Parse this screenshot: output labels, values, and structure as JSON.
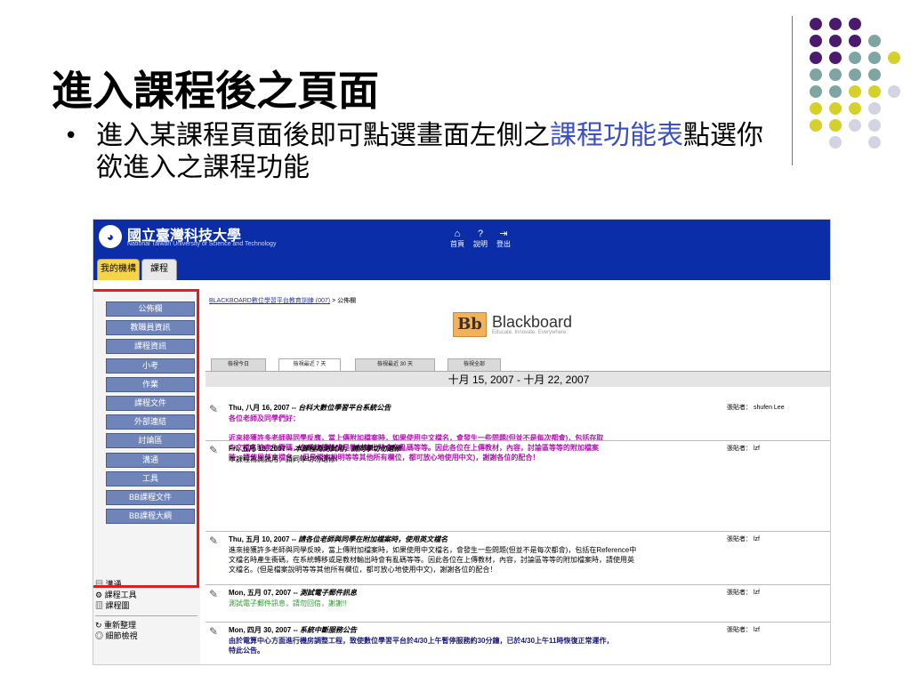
{
  "slide": {
    "title": "進入課程後之頁面",
    "bullet_pre": "進入某課程頁面後即可點選畫面左側之",
    "bullet_highlight": "課程功能表",
    "bullet_post": "點選你欲進入之課程功能",
    "bullet_marker": "•",
    "colors": {
      "title": "#000000",
      "highlight": "#3a4fc0",
      "dot_purple": "#4b1a6e",
      "dot_teal": "#7fa5a3",
      "dot_yellow": "#d6d12a",
      "dot_lavender": "#d3d3e4"
    }
  },
  "screenshot": {
    "logo_mark": "◕",
    "university_name": "國立臺灣科技大學",
    "university_name_en": "National Taiwan University of Science and Technology",
    "tabs": [
      "我的機構",
      "課程"
    ],
    "top_nav": [
      {
        "icon": "home-icon",
        "glyph": "⌂",
        "label": "首頁"
      },
      {
        "icon": "help-icon",
        "glyph": "?",
        "label": "說明"
      },
      {
        "icon": "logout-icon",
        "glyph": "⇥",
        "label": "登出"
      }
    ],
    "course_menu": [
      "公佈欄",
      "教職員資訊",
      "課程資訊",
      "小考",
      "作業",
      "課程文件",
      "外部連結",
      "討論區",
      "溝通",
      "工具",
      "BB課程文件",
      "BB課程大綱"
    ],
    "tools": {
      "comm": "溝通",
      "course_tools": "課程工具",
      "course_map": "課程圖",
      "refresh": "重新整理",
      "detail_view": "細節檢視"
    },
    "breadcrumb_link": "BLACKBOARD數位學習平台教育訓練 (007)",
    "breadcrumb_sep": ">",
    "breadcrumb_current": "公佈欄",
    "blackboard": {
      "mark": "Bb",
      "word": "Blackboard",
      "tagline": "Educate. Innovate. Everywhere."
    },
    "filter_tabs": [
      "檢視今日",
      "檢視最近 7 天",
      "檢視最近 30 天",
      "檢視全部"
    ],
    "date_range": "十月 15, 2007 - 十月 22, 2007",
    "announcements": [
      {
        "date": "Thu, 八月 16, 2007",
        "dash": " -- ",
        "title": "台科大數位學習平台系統公告",
        "poster_label": "張貼者：",
        "poster": "shufen Lee",
        "body_lines": [
          "各位老師及同學們好：",
          "",
          "近來接獲許多老師與同學反應，當上傳附加檔案時，如果使用中文檔名，會發生一些問題(但並不是每次都會)，包括存取",
          "中文檔名時產生衝碼，在系統轉移或是教材輸出時會有亂碼等等。因此各位在上傳教材，內容，討論區等等的附加檔案",
          "時，請使用英文檔名。(但是檔案說明等等其他所有欄位，都可放心地使用中文)，謝謝各位的配合！"
        ],
        "color": "pur"
      },
      {
        "date": "Fri, 五月 18, 2007",
        "dash": " -- ",
        "title": "本課程為測試用，請同學切勿選修",
        "poster_label": "張貼者：",
        "poster": "lzf",
        "body_lines": [
          "本課程為測試用，請同學切勿選修!"
        ],
        "color": "blk"
      },
      {
        "date": "Thu, 五月 10, 2007",
        "dash": " -- ",
        "title": "請各位老師與同學在附加檔案時，使用英文檔名",
        "poster_label": "張貼者：",
        "poster": "lzf",
        "body_lines": [
          "進來接獲許多老師與同學反映，當上傳附加檔案時，如果使用中文檔名，會發生一些問題(但並不是每次都會)，包括在Reference中",
          "文檔名時產生衝碼，在系統轉移或是教材輸出時會有亂碼等等。因此各位在上傳教材，內容，討論區等等的附加檔案時，請使用英",
          "文檔名。(但是檔案說明等等其他所有欄位，都可放心地使用中文)，謝謝各位的配合！"
        ],
        "color": "blk"
      },
      {
        "date": "Mon, 五月 07, 2007",
        "dash": " -- ",
        "title": "測試電子郵件訊息",
        "poster_label": "張貼者：",
        "poster": "lzf",
        "body_lines": [
          "測試電子郵件訊息，請勿回信，謝謝!!"
        ],
        "color": "grn"
      },
      {
        "date": "Mon, 四月 30, 2007",
        "dash": " -- ",
        "title": "系統中斷服務公告",
        "poster_label": "張貼者：",
        "poster": "lzf",
        "body_lines": [
          "由於電算中心方面進行機房調整工程，致使數位學習平台於4/30上午暫停服務約30分鐘，已於4/30上午11時恢復正常運作，",
          "特此公告。"
        ],
        "color": "nav"
      }
    ]
  }
}
